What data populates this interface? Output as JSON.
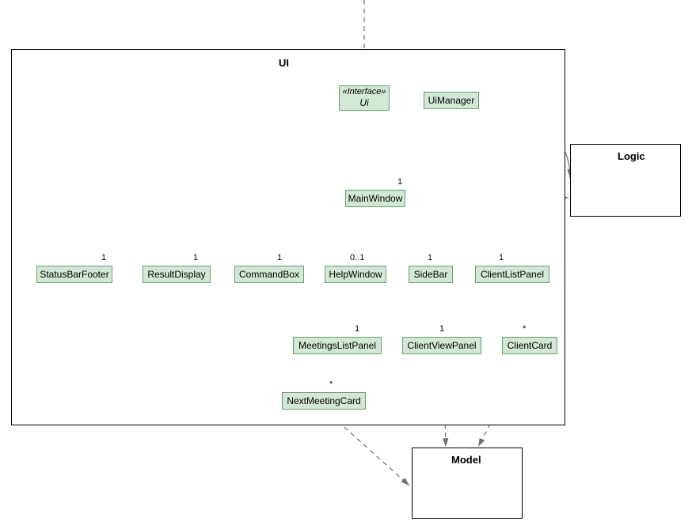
{
  "packages": {
    "ui": {
      "label": "UI"
    },
    "logic": {
      "label": "Logic"
    },
    "model": {
      "label": "Model"
    }
  },
  "nodes": {
    "ui_interface": {
      "stereo": "«Interface»",
      "name": "Ui"
    },
    "uimanager": {
      "name": "UiManager"
    },
    "mainwindow": {
      "name": "MainWindow"
    },
    "statusbarfooter": {
      "name": "StatusBarFooter"
    },
    "resultdisplay": {
      "name": "ResultDisplay"
    },
    "commandbox": {
      "name": "CommandBox"
    },
    "helpwindow": {
      "name": "HelpWindow"
    },
    "sidebar": {
      "name": "SideBar"
    },
    "clientlistpanel": {
      "name": "ClientListPanel"
    },
    "meetingslistpanel": {
      "name": "MeetingsListPanel"
    },
    "clientviewpanel": {
      "name": "ClientViewPanel"
    },
    "clientcard": {
      "name": "ClientCard"
    },
    "nextmeetingcard": {
      "name": "NextMeetingCard"
    }
  },
  "multiplicities": {
    "mw": "1",
    "sbf": "1",
    "rd": "1",
    "cb": "1",
    "hw": "0..1",
    "sb": "1",
    "clp": "1",
    "mlp": "1",
    "cvp": "1",
    "cc": "*",
    "nmc": "*"
  }
}
